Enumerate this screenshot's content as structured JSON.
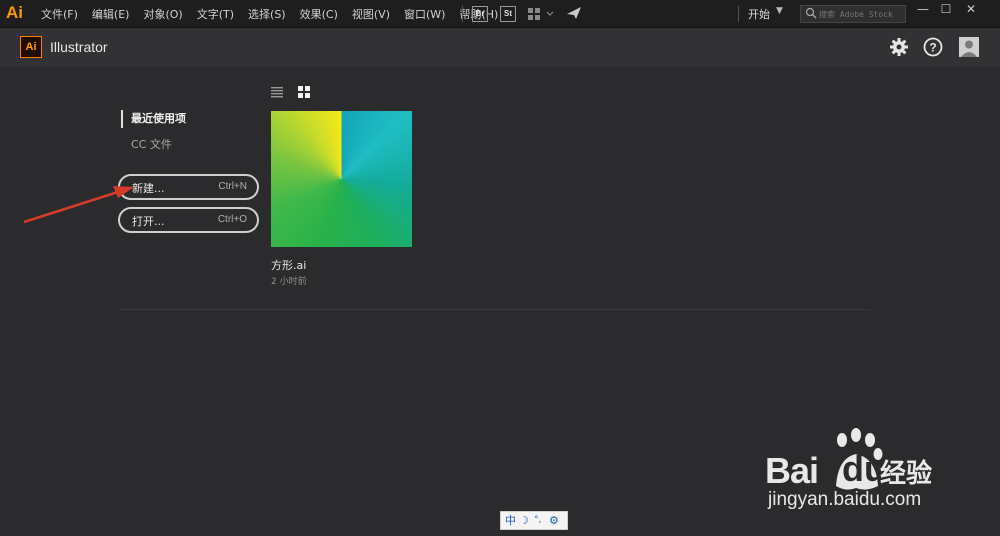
{
  "menubar": {
    "logo": "Ai",
    "items": [
      "文件(F)",
      "编辑(E)",
      "对象(O)",
      "文字(T)",
      "选择(S)",
      "效果(C)",
      "视图(V)",
      "窗口(W)",
      "帮助(H)"
    ],
    "bridge_label": "Br",
    "stock_label": "St",
    "workspace": "开始",
    "stock_search_placeholder": "搜索 Adobe Stock"
  },
  "window_controls": {
    "minimize": "—",
    "maximize": "☐",
    "close": "✕"
  },
  "header": {
    "app_icon": "Ai",
    "app_name": "Illustrator",
    "icons": [
      "gear-icon",
      "help-icon",
      "account-icon"
    ]
  },
  "left_nav": {
    "active": "最近使用项",
    "cc_files": "CC 文件"
  },
  "buttons": {
    "new_label": "新建...",
    "new_shortcut": "Ctrl+N",
    "open_label": "打开...",
    "open_shortcut": "Ctrl+O"
  },
  "view_toggle": [
    "list-view-icon",
    "grid-view-icon"
  ],
  "recent_files": [
    {
      "name": "方形.ai",
      "time": "2 小时前"
    }
  ],
  "ime": {
    "mode": "中",
    "moon": "☽",
    "punct": "°,",
    "gear": "⚙"
  },
  "watermark": {
    "brand": "Bai",
    "paw": "du",
    "text": "经验",
    "url": "jingyan.baidu.com"
  },
  "colors": {
    "accent": "#ff9a00",
    "annotation_arrow": "#d63a2a"
  }
}
